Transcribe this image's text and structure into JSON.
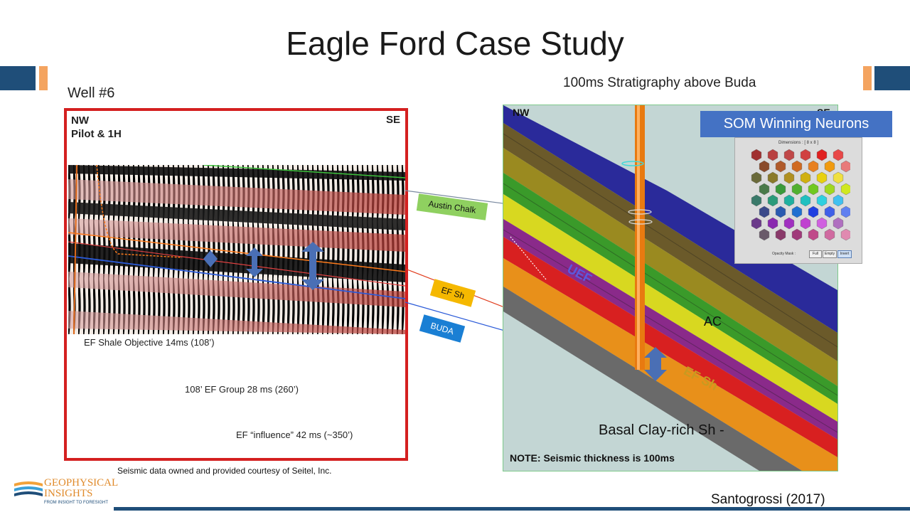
{
  "slide": {
    "title": "Eagle Ford Case Study",
    "well_label": "Well #6",
    "strat_label": "100ms Stratigraphy above Buda"
  },
  "left_panel": {
    "nw": "NW",
    "pilot": "Pilot &  1H",
    "se": "SE",
    "annotations": [
      "EF Shale Objective 14ms (108’)",
      "108’ EF Group 28 ms (260’)",
      "EF “influence” 42 ms (~350’)"
    ],
    "credit": "Seismic data owned and provided courtesy of Seitel, Inc."
  },
  "tags": {
    "austin_chalk": "Austin Chalk",
    "ef_sh": "EF Sh",
    "buda": "BUDA"
  },
  "right_panel": {
    "nw": "NW",
    "se": "SE",
    "uef": "UEF",
    "ac": "AC",
    "efsh": "EF Sh",
    "basal": "Basal Clay-rich Sh -",
    "note": "NOTE:   Seismic thickness is 100ms"
  },
  "som": {
    "title": "SOM Winning Neurons",
    "dimensions": "Dimensions :  [ 8 x 8 ]",
    "opacity_label": "Opacity Mask :",
    "buttons": [
      "Full",
      "Empty",
      "Invert"
    ]
  },
  "citation": "Santogrossi (2017)",
  "logo": {
    "line1": "GEOPHYSICAL",
    "line2": "INSIGHTS",
    "tagline": "FROM INSIGHT TO FORESIGHT"
  }
}
